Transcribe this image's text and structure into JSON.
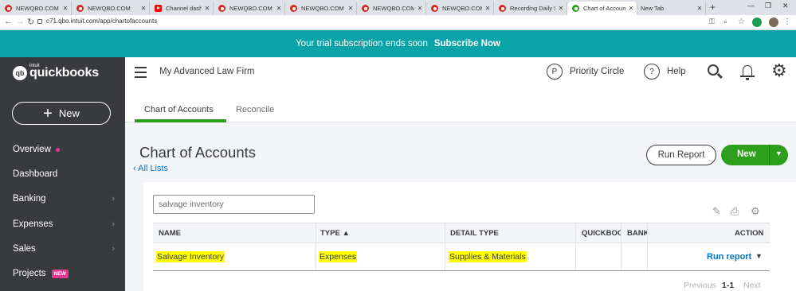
{
  "browser": {
    "tabs": [
      {
        "title": "NEWQBO.COM",
        "icon": "qbo-favicon"
      },
      {
        "title": "NEWQBO.COM",
        "icon": "qbo-favicon"
      },
      {
        "title": "Channel dashboard",
        "icon": "youtube-favicon"
      },
      {
        "title": "NEWQBO.COM",
        "icon": "qbo-favicon"
      },
      {
        "title": "NEWQBO.COM",
        "icon": "qbo-favicon"
      },
      {
        "title": "NEWQBO.COM",
        "icon": "qbo-favicon"
      },
      {
        "title": "NEWQBO.COM",
        "icon": "qbo-favicon"
      },
      {
        "title": "Recording Daily Sal",
        "icon": "qbo-favicon"
      },
      {
        "title": "Chart of Accounts",
        "icon": "quickbooks-favicon",
        "active": true
      },
      {
        "title": "New Tab",
        "icon": "none"
      }
    ],
    "url": "c71.qbo.intuit.com/app/chartofaccounts"
  },
  "banner": {
    "text": "Your trial subscription ends soon",
    "link": "Subscribe Now",
    "color": "#0aa3a8"
  },
  "sidebar": {
    "logo_small": "intuit",
    "logo": "quickbooks",
    "new_button": "New",
    "items": [
      {
        "label": "Overview",
        "dot": true
      },
      {
        "label": "Dashboard"
      },
      {
        "label": "Banking",
        "chevron": true
      },
      {
        "label": "Expenses",
        "chevron": true
      },
      {
        "label": "Sales",
        "chevron": true
      },
      {
        "label": "Projects",
        "badge": "NEW"
      }
    ]
  },
  "header": {
    "company": "My Advanced Law Firm",
    "priority_circle": "Priority Circle",
    "help": "Help"
  },
  "page_tabs": [
    "Chart of Accounts",
    "Reconcile"
  ],
  "page": {
    "title": "Chart of Accounts",
    "all_lists": "All Lists",
    "run_report": "Run Report",
    "new": "New"
  },
  "search": {
    "value": "salvage inventory"
  },
  "table": {
    "columns": [
      "NAME",
      "TYPE ▲",
      "DETAIL TYPE",
      "QUICKBOOKS BALANCE",
      "BANK BALANCE",
      "ACTION"
    ],
    "rows": [
      {
        "name": "Salvage Inventory",
        "type": "Expenses",
        "detail_type": "Supplies & Materials",
        "qb_balance": "",
        "bank_balance": "",
        "action": "Run report"
      }
    ]
  },
  "pagination": {
    "previous": "Previous",
    "range": "1-1",
    "next": "Next"
  },
  "colors": {
    "brand_green": "#2ca01c",
    "sidebar": "#393a3d",
    "link": "#0077c5",
    "highlight": "#ffff00"
  }
}
